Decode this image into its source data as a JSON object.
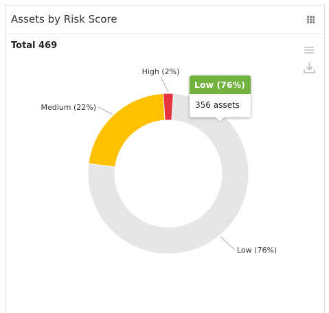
{
  "widget": {
    "title": "Assets by Risk Score",
    "total_label": "Total 469"
  },
  "icons": {
    "grid": "grid-icon",
    "menu": "hamburger-menu-icon",
    "download": "download-icon"
  },
  "tooltip": {
    "header": "Low (76%)",
    "body": "356 assets",
    "color": "#71b33c"
  },
  "chart_data": {
    "type": "pie",
    "variant": "donut",
    "title": "Assets by Risk Score",
    "total": 469,
    "slices": [
      {
        "name": "Low",
        "label": "Low (76%)",
        "percent": 76,
        "value": 356,
        "color": "#e6e6e6"
      },
      {
        "name": "Medium",
        "label": "Medium (22%)",
        "percent": 22,
        "color": "#ffc000"
      },
      {
        "name": "High",
        "label": "High (2%)",
        "percent": 2,
        "color": "#e5333f"
      }
    ]
  }
}
